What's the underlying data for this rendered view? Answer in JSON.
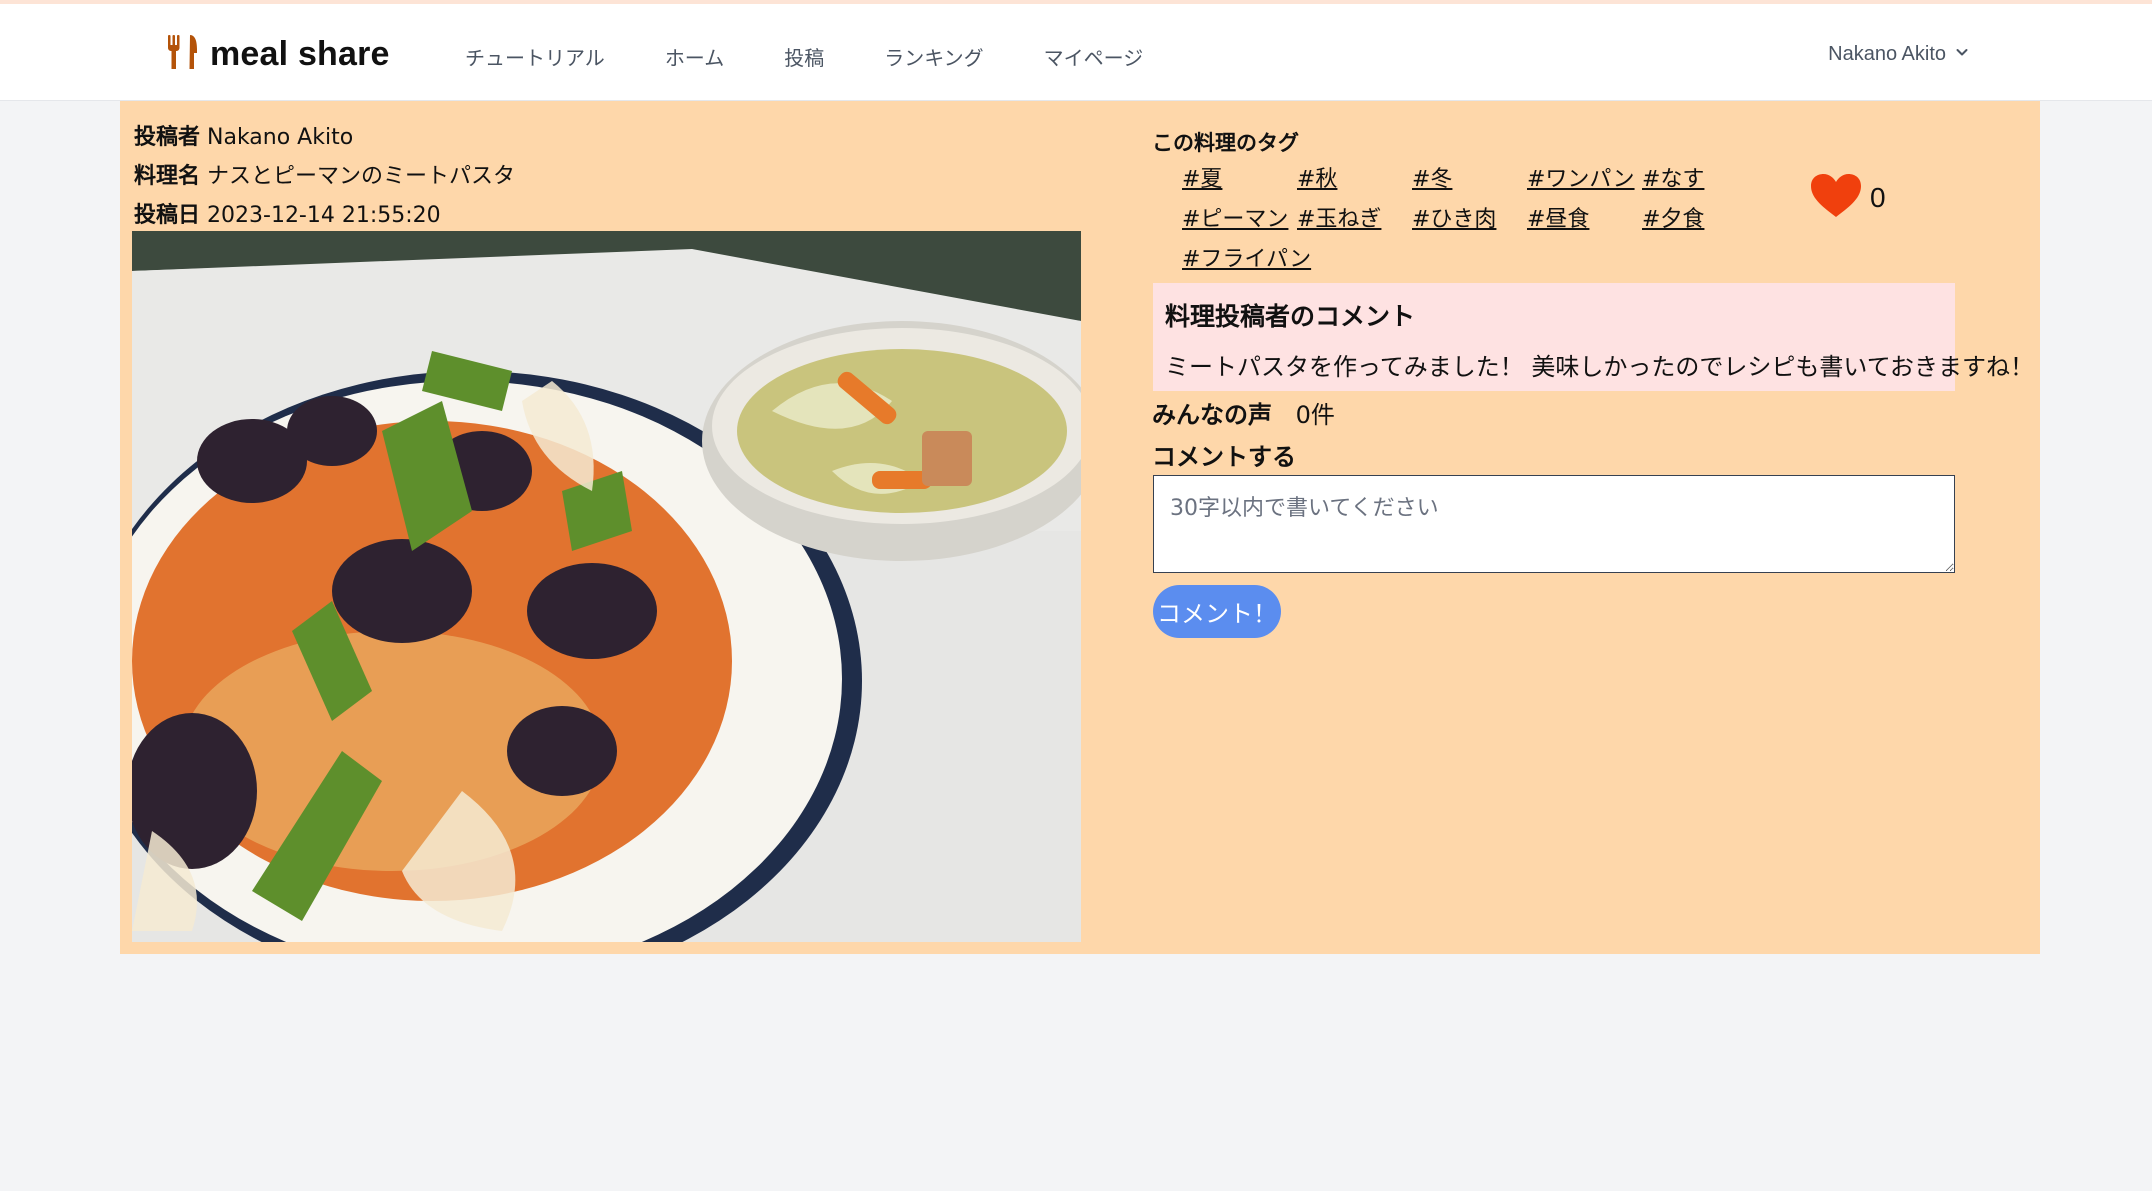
{
  "colors": {
    "card_bg": "#fed7aa",
    "comment_bg": "#fee2e2",
    "button": "#5b8def",
    "heart": "#f0400d",
    "logo_icon": "#b45309"
  },
  "header": {
    "logo_text": "meal share",
    "logo_icon": "fork-knife-icon",
    "nav": [
      "チュートリアル",
      "ホーム",
      "投稿",
      "ランキング",
      "マイページ"
    ],
    "user_name": "Nakano Akito",
    "user_icon": "chevron-down-icon"
  },
  "post": {
    "author_label": "投稿者",
    "author": "Nakano Akito",
    "dish_label": "料理名",
    "dish": "ナスとピーマンのミートパスタ",
    "date_label": "投稿日",
    "date": "2023-12-14 21:55:20",
    "photo_icon": "dish-photo"
  },
  "tags": {
    "title": "この料理のタグ",
    "items": [
      "#夏",
      "#秋",
      "#冬",
      "#ワンパン",
      "#なす",
      "#ピーマン",
      "#玉ねぎ",
      "#ひき肉",
      "#昼食",
      "#夕食",
      "#フライパン"
    ]
  },
  "like": {
    "icon": "heart-icon",
    "count": "0"
  },
  "author_comment": {
    "title": "料理投稿者のコメント",
    "text": "ミートパスタを作ってみました！ 美味しかったのでレシピも書いておきますね！"
  },
  "voices": {
    "label": "みんなの声",
    "count": "0件"
  },
  "comment_form": {
    "label": "コメントする",
    "placeholder": "30字以内で書いてください",
    "submit": "コメント！"
  }
}
